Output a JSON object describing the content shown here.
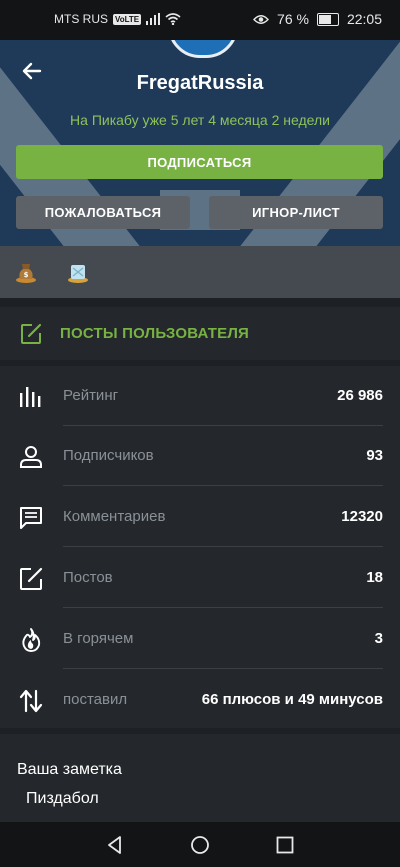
{
  "status_bar": {
    "carrier": "MTS RUS",
    "volte": "VoLTE",
    "battery_percent": "76 %",
    "battery_level": 0.76,
    "time": "22:05"
  },
  "profile": {
    "username": "FregatRussia",
    "member_since": "На Пикабу уже 5 лет 4 месяца 2 недели",
    "subscribe_label": "ПОДПИСАТЬСЯ",
    "report_label": "ПОЖАЛОВАТЬСЯ",
    "ignore_label": "ИГНОР-ЛИСТ"
  },
  "awards": [
    "money-bag-award-icon",
    "ice-award-icon"
  ],
  "posts_link": {
    "label": "ПОСТЫ ПОЛЬЗОВАТЕЛЯ"
  },
  "stats": [
    {
      "icon": "bar-chart-icon",
      "label": "Рейтинг",
      "value": "26 986"
    },
    {
      "icon": "person-icon",
      "label": "Подписчиков",
      "value": "93"
    },
    {
      "icon": "comment-icon",
      "label": "Комментариев",
      "value": "12320"
    },
    {
      "icon": "edit-icon",
      "label": "Постов",
      "value": "18"
    },
    {
      "icon": "fire-icon",
      "label": "В горячем",
      "value": "3"
    },
    {
      "icon": "sort-arrows-icon",
      "label": "поставил",
      "value": "66 плюсов и 49 минусов"
    }
  ],
  "note": {
    "title": "Ваша заметка",
    "text": "Пиздабол"
  },
  "colors": {
    "accent_green": "#77b243",
    "header_blue": "#1e3a58",
    "background": "#1d2125",
    "card": "#24282c"
  }
}
